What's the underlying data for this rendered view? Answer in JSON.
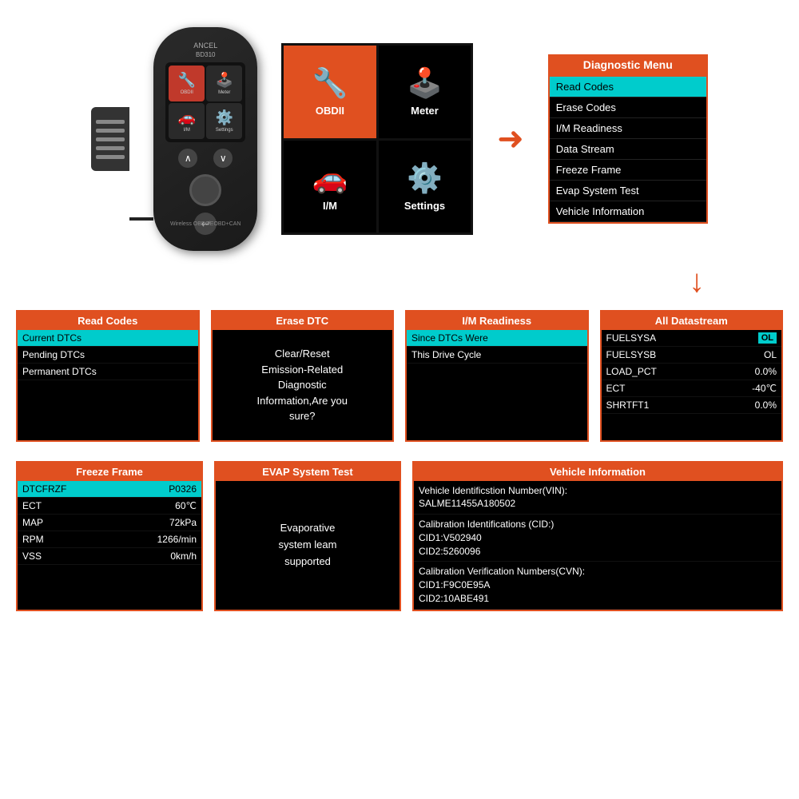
{
  "device": {
    "brand": "ANCEL",
    "model": "BD310",
    "label": "Wireless OBD6/EOBD+CAN"
  },
  "menuGrid": {
    "items": [
      {
        "id": "obdii",
        "label": "OBDII",
        "icon": "🔧",
        "selected": true
      },
      {
        "id": "meter",
        "label": "Meter",
        "icon": "🕹️",
        "selected": false
      },
      {
        "id": "im",
        "label": "I/M",
        "icon": "🚗",
        "selected": false
      },
      {
        "id": "settings",
        "label": "Settings",
        "icon": "⚙️",
        "selected": false
      }
    ]
  },
  "diagnosticMenu": {
    "title": "Diagnostic Menu",
    "items": [
      {
        "label": "Read Codes",
        "highlighted": true
      },
      {
        "label": "Erase Codes",
        "highlighted": false
      },
      {
        "label": "I/M Readiness",
        "highlighted": false
      },
      {
        "label": "Data Stream",
        "highlighted": false
      },
      {
        "label": "Freeze Frame",
        "highlighted": false
      },
      {
        "label": "Evap System Test",
        "highlighted": false
      },
      {
        "label": "Vehicle Information",
        "highlighted": false
      }
    ]
  },
  "panels": {
    "readCodes": {
      "header": "Read Codes",
      "rows": [
        {
          "label": "Current DTCs",
          "value": "",
          "highlighted": true
        },
        {
          "label": "Pending DTCs",
          "value": "",
          "highlighted": false
        },
        {
          "label": "Permanent DTCs",
          "value": "",
          "highlighted": false
        }
      ]
    },
    "eraseDTC": {
      "header": "Erase DTC",
      "content": "Clear/Reset\nEmission-Related\nDiagnostic\nInformation,Are you\nsure?"
    },
    "imReadiness": {
      "header": "I/M Readiness",
      "rows": [
        {
          "label": "Since DTCs Were",
          "value": "",
          "highlighted": true
        },
        {
          "label": "This Drive Cycle",
          "value": "",
          "highlighted": false
        }
      ]
    },
    "allDatastream": {
      "header": "All Datastream",
      "rows": [
        {
          "label": "FUELSYSA",
          "value": "OL",
          "highlighted": true,
          "valueCyan": true
        },
        {
          "label": "FUELSYSB",
          "value": "OL",
          "highlighted": false
        },
        {
          "label": "LOAD_PCT",
          "value": "0.0%",
          "highlighted": false
        },
        {
          "label": "ECT",
          "value": "-40℃",
          "highlighted": false
        },
        {
          "label": "SHRTFT1",
          "value": "0.0%",
          "highlighted": false
        }
      ]
    },
    "freezeFrame": {
      "header": "Freeze Frame",
      "rows": [
        {
          "label": "DTCFRZF",
          "value": "P0326",
          "highlighted": true
        },
        {
          "label": "ECT",
          "value": "60℃",
          "highlighted": false
        },
        {
          "label": "MAP",
          "value": "72kPa",
          "highlighted": false
        },
        {
          "label": "RPM",
          "value": "1266/min",
          "highlighted": false
        },
        {
          "label": "VSS",
          "value": "0km/h",
          "highlighted": false
        }
      ]
    },
    "evapSystemTest": {
      "header": "EVAP System Test",
      "content": "Evaporative\nsystem leam\nsupported"
    },
    "vehicleInformation": {
      "header": "Vehicle Information",
      "rows": [
        {
          "label": "Vehicle Identificstion Number(VIN):\nSALME11455A180502",
          "value": ""
        },
        {
          "label": "Calibration Identifications (CID:)\nCID1:V502940\nCID2:5260096",
          "value": ""
        },
        {
          "label": "Calibration Verification Numbers(CVN):\nCID1:F9C0E95A\nCID2:10ABE491",
          "value": ""
        }
      ]
    }
  }
}
